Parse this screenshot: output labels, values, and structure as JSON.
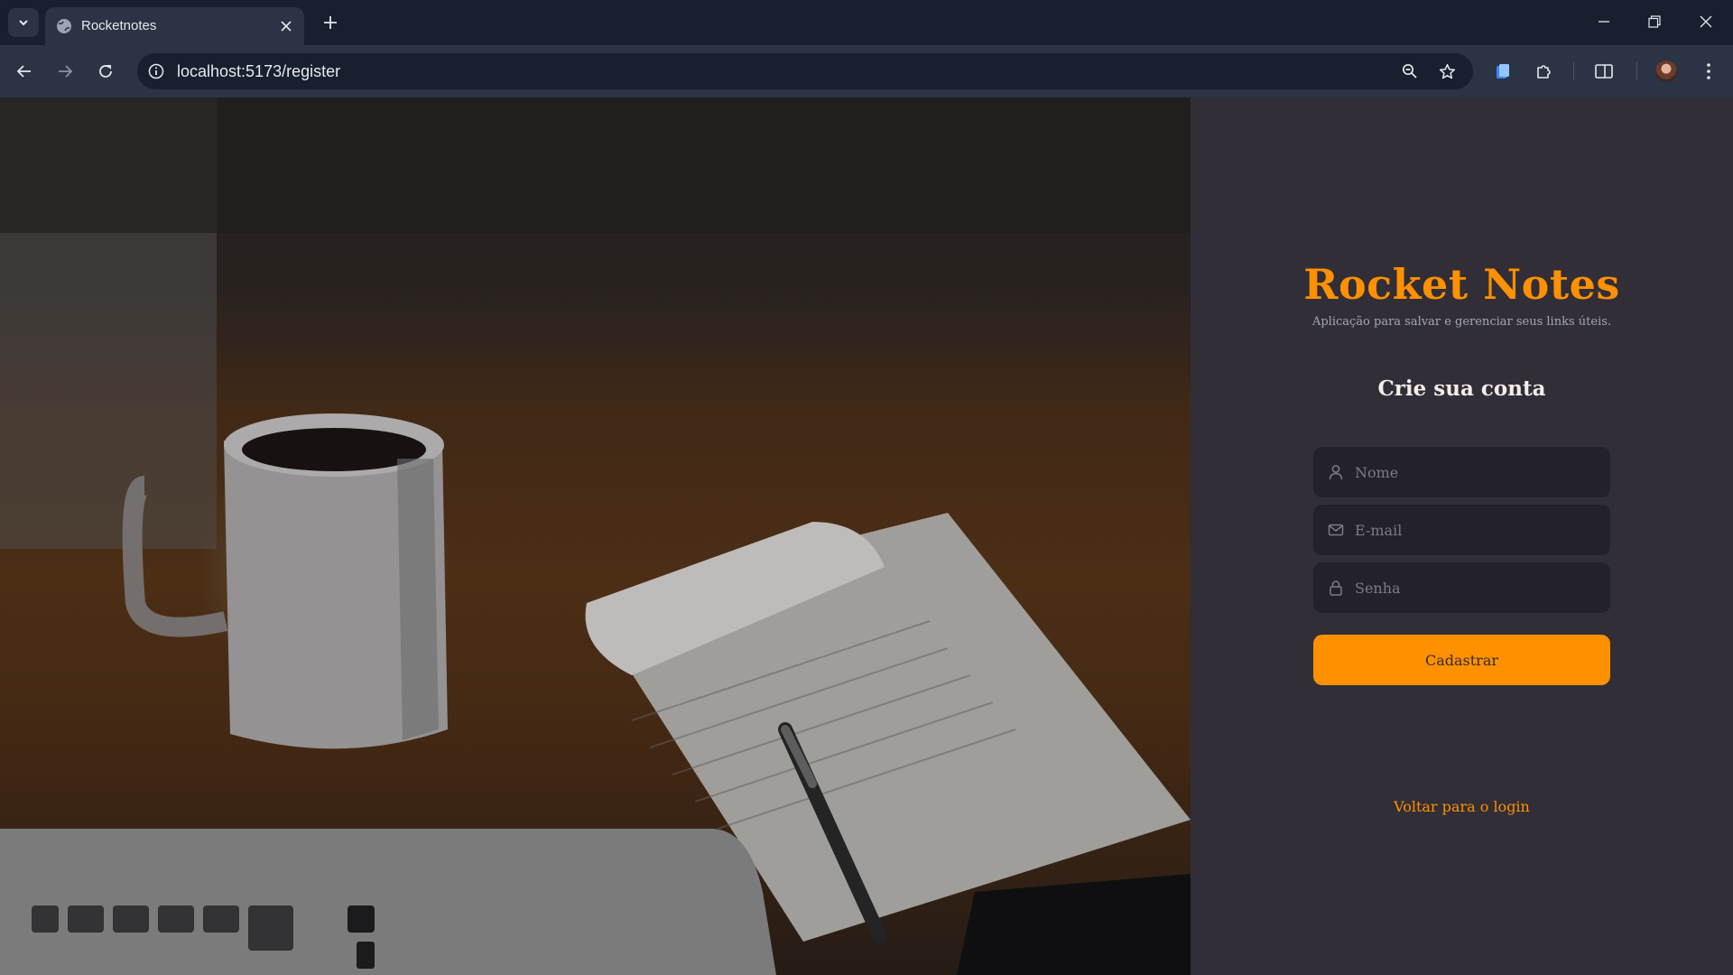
{
  "browser": {
    "tab_title": "Rocketnotes",
    "url": "localhost:5173/register"
  },
  "app": {
    "brand": "Rocket Notes",
    "tagline": "Aplicação para salvar e gerenciar seus links úteis.",
    "form_title": "Crie sua conta",
    "fields": {
      "name_placeholder": "Nome",
      "email_placeholder": "E-mail",
      "password_placeholder": "Senha"
    },
    "submit_label": "Cadastrar",
    "back_link": "Voltar para o login",
    "colors": {
      "accent": "#ff9000",
      "panel_bg": "#312e38",
      "input_bg": "#232129"
    }
  },
  "icons": [
    "tab-search-icon",
    "globe-icon",
    "close-icon",
    "plus-icon",
    "minimize-icon",
    "restore-icon",
    "window-close-icon",
    "back-icon",
    "forward-icon",
    "reload-icon",
    "info-icon",
    "zoom-icon",
    "star-icon",
    "clipboard-extension-icon",
    "puzzle-icon",
    "split-screen-icon",
    "kebab-menu-icon",
    "user-icon",
    "mail-icon",
    "lock-icon"
  ]
}
